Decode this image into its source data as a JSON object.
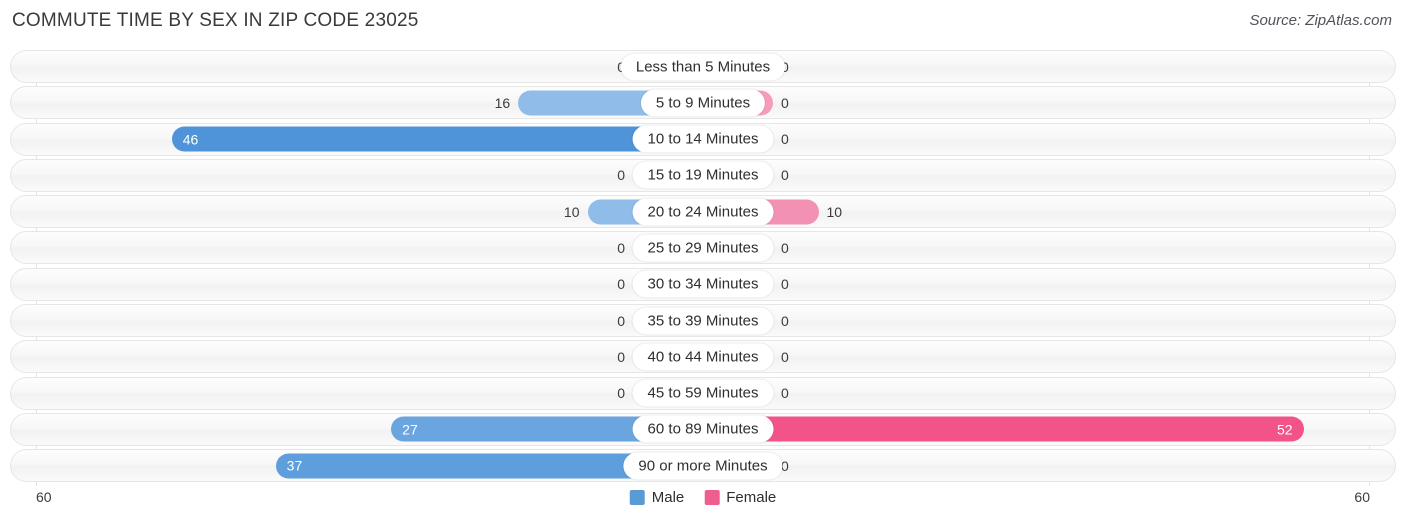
{
  "header": {
    "title": "COMMUTE TIME BY SEX IN ZIP CODE 23025",
    "source": "Source: ZipAtlas.com"
  },
  "legend": {
    "male_label": "Male",
    "female_label": "Female",
    "male_color": "#5b9bd5",
    "female_color": "#ef5f8d"
  },
  "axis": {
    "left_max": "60",
    "right_max": "60"
  },
  "chart_data": {
    "type": "bar",
    "title": "COMMUTE TIME BY SEX IN ZIP CODE 23025",
    "subtitle": "Source: ZipAtlas.com",
    "orientation": "horizontal-diverging",
    "xlabel": "",
    "ylabel": "",
    "xlim": [
      60,
      60
    ],
    "grid": false,
    "legend_position": "bottom-center",
    "categories": [
      "Less than 5 Minutes",
      "5 to 9 Minutes",
      "10 to 14 Minutes",
      "15 to 19 Minutes",
      "20 to 24 Minutes",
      "25 to 29 Minutes",
      "30 to 34 Minutes",
      "35 to 39 Minutes",
      "40 to 44 Minutes",
      "45 to 59 Minutes",
      "60 to 89 Minutes",
      "90 or more Minutes"
    ],
    "series": [
      {
        "name": "Male",
        "values": [
          0,
          16,
          46,
          0,
          10,
          0,
          0,
          0,
          0,
          0,
          27,
          37
        ]
      },
      {
        "name": "Female",
        "values": [
          0,
          0,
          0,
          0,
          10,
          0,
          0,
          0,
          0,
          0,
          52,
          0
        ]
      }
    ]
  },
  "rows": [
    {
      "label": "Less than 5 Minutes",
      "male": "0",
      "female": "0"
    },
    {
      "label": "5 to 9 Minutes",
      "male": "16",
      "female": "0"
    },
    {
      "label": "10 to 14 Minutes",
      "male": "46",
      "female": "0"
    },
    {
      "label": "15 to 19 Minutes",
      "male": "0",
      "female": "0"
    },
    {
      "label": "20 to 24 Minutes",
      "male": "10",
      "female": "10"
    },
    {
      "label": "25 to 29 Minutes",
      "male": "0",
      "female": "0"
    },
    {
      "label": "30 to 34 Minutes",
      "male": "0",
      "female": "0"
    },
    {
      "label": "35 to 39 Minutes",
      "male": "0",
      "female": "0"
    },
    {
      "label": "40 to 44 Minutes",
      "male": "0",
      "female": "0"
    },
    {
      "label": "45 to 59 Minutes",
      "male": "0",
      "female": "0"
    },
    {
      "label": "60 to 89 Minutes",
      "male": "27",
      "female": "52"
    },
    {
      "label": "90 or more Minutes",
      "male": "37",
      "female": "0"
    }
  ]
}
